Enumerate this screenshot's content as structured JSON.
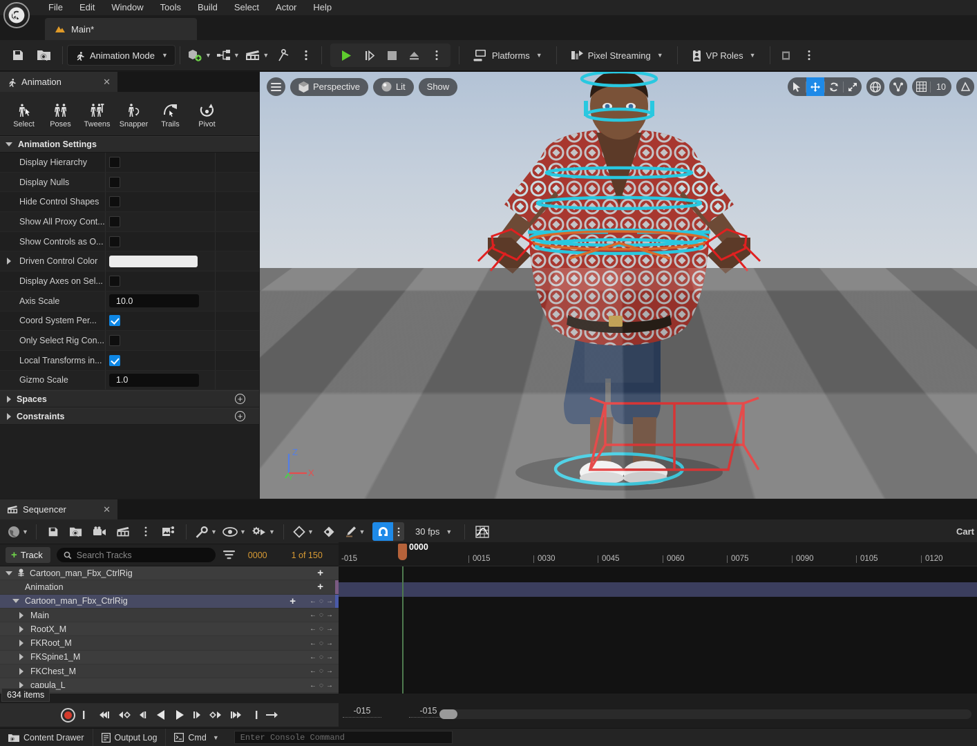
{
  "app": {
    "logo_icon": "unreal-engine-logo"
  },
  "menubar": {
    "items": [
      {
        "label": "File"
      },
      {
        "label": "Edit"
      },
      {
        "label": "Window"
      },
      {
        "label": "Tools"
      },
      {
        "label": "Build"
      },
      {
        "label": "Select"
      },
      {
        "label": "Actor"
      },
      {
        "label": "Help"
      }
    ]
  },
  "level_tab": {
    "label": "Main*",
    "icon": "level-icon"
  },
  "main_toolbar": {
    "save_icon": "save-icon",
    "browse_icon": "browse-content-icon",
    "mode_label": "Animation Mode",
    "mode_icon": "animation-mode-icon",
    "add_icon": "add-actor-icon",
    "blueprint_icon": "blueprints-icon",
    "cinematics_icon": "cinematics-icon",
    "tools_icon": "virtual-production-icon",
    "more_icon": "more-options-icon",
    "play_icon": "play-icon",
    "skipplay_icon": "play-step-icon",
    "stop_icon": "stop-icon",
    "eject_icon": "eject-icon",
    "play_more_icon": "play-options-icon",
    "platforms_label": "Platforms",
    "platforms_icon": "platforms-icon",
    "pixel_streaming_label": "Pixel Streaming",
    "pixel_streaming_icon": "pixel-streaming-icon",
    "vp_roles_label": "VP Roles",
    "vp_roles_icon": "vp-roles-icon",
    "vcam_icon": "vcam-icon",
    "settings_more_icon": "settings-more-icon"
  },
  "animation_panel": {
    "tab_label": "Animation",
    "tab_icon": "animation-icon",
    "close_icon": "close-icon",
    "tools": [
      {
        "label": "Select",
        "icon": "select-tool-icon"
      },
      {
        "label": "Poses",
        "icon": "poses-tool-icon"
      },
      {
        "label": "Tweens",
        "icon": "tweens-tool-icon"
      },
      {
        "label": "Snapper",
        "icon": "snapper-tool-icon"
      },
      {
        "label": "Trails",
        "icon": "trails-tool-icon"
      },
      {
        "label": "Pivot",
        "icon": "pivot-tool-icon"
      }
    ],
    "section_title": "Animation Settings",
    "properties": [
      {
        "label": "Display Hierarchy",
        "type": "checkbox",
        "value": false,
        "expandable": false
      },
      {
        "label": "Display Nulls",
        "type": "checkbox",
        "value": false,
        "expandable": false
      },
      {
        "label": "Hide Control Shapes",
        "type": "checkbox",
        "value": false,
        "expandable": false
      },
      {
        "label": "Show All Proxy Cont...",
        "type": "checkbox",
        "value": false,
        "expandable": false
      },
      {
        "label": "Show Controls as O...",
        "type": "checkbox",
        "value": false,
        "expandable": false
      },
      {
        "label": "Driven Control Color",
        "type": "color",
        "value": "#ececec",
        "expandable": true
      },
      {
        "label": "Display Axes on Sel...",
        "type": "checkbox",
        "value": false,
        "expandable": false
      },
      {
        "label": "Axis Scale",
        "type": "number",
        "value": "10.0",
        "expandable": false
      },
      {
        "label": "Coord System Per...",
        "type": "checkbox",
        "value": true,
        "expandable": false
      },
      {
        "label": "Only Select Rig Con...",
        "type": "checkbox",
        "value": false,
        "expandable": false
      },
      {
        "label": "Local Transforms in...",
        "type": "checkbox",
        "value": true,
        "expandable": false
      },
      {
        "label": "Gizmo Scale",
        "type": "number",
        "value": "1.0",
        "expandable": false
      }
    ],
    "categories": [
      {
        "label": "Spaces",
        "add_icon": "add-circle-icon"
      },
      {
        "label": "Constraints",
        "add_icon": "add-circle-icon"
      }
    ]
  },
  "viewport": {
    "menu_icon": "viewport-menu-icon",
    "view_mode_label": "Perspective",
    "view_mode_icon": "perspective-cube-icon",
    "lighting_label": "Lit",
    "lighting_icon": "lit-sphere-icon",
    "show_label": "Show",
    "transform_tools": [
      {
        "icon": "select-cursor-icon",
        "active": false
      },
      {
        "icon": "move-gizmo-icon",
        "active": true
      },
      {
        "icon": "rotate-gizmo-icon",
        "active": false
      },
      {
        "icon": "scale-gizmo-icon",
        "active": false
      }
    ],
    "coord_icon": "world-coordinate-icon",
    "surface_snap_icon": "surface-snapping-icon",
    "grid_snap_icon": "grid-snap-icon",
    "grid_snap_value": "10",
    "angle_snap_icon": "angle-snap-icon",
    "gizmo_axes": [
      "Z",
      "X",
      "Y"
    ]
  },
  "sequencer": {
    "tab_label": "Sequencer",
    "tab_icon": "sequencer-icon",
    "close_icon": "close-icon",
    "toolbar": {
      "world_icon": "world-outliner-icon",
      "save_icon": "save-icon",
      "save_as_icon": "save-as-icon",
      "camera_icon": "create-camera-icon",
      "sequence_icon": "sequence-icon",
      "more_icon": "more-options-icon",
      "actions_icon": "sequencer-actions-icon",
      "wrench_icon": "wrench-icon",
      "eye_icon": "visibility-icon",
      "playback_icon": "playback-options-icon",
      "key_icon": "key-interpolation-icon",
      "key_area_icon": "key-area-icon",
      "pencil_icon": "autokey-icon",
      "snap_icon": "snap-magnet-icon",
      "snap_active": true,
      "snap_more_icon": "snap-options-icon",
      "fps_label": "30 fps",
      "curve_editor_icon": "curve-editor-icon",
      "right_label": "Cart"
    },
    "add_row": {
      "track_button_label": "Track",
      "track_button_icon": "plus-icon",
      "search_placeholder": "Search Tracks",
      "search_icon": "search-icon",
      "filter_icon": "filter-icon",
      "frame_counter": "0000",
      "selection_counter": "1 of 150"
    },
    "tracks": [
      {
        "label": "Cartoon_man_Fbx_CtrlRig",
        "indent": 0,
        "expander": "down",
        "icon": "skeleton-icon",
        "add": true,
        "keynav": false
      },
      {
        "label": "Animation",
        "indent": 1,
        "expander": "none",
        "icon": "none",
        "add": true,
        "keynav": false,
        "accent": "#7a5a82"
      },
      {
        "label": "Cartoon_man_Fbx_CtrlRig",
        "indent": 1,
        "expander": "down",
        "icon": "none",
        "add": true,
        "keynav": true,
        "selected": true,
        "accent": "#4a5aa8"
      },
      {
        "label": "Main",
        "indent": 2,
        "expander": "right",
        "icon": "none",
        "add": false,
        "keynav": true
      },
      {
        "label": "RootX_M",
        "indent": 2,
        "expander": "right",
        "icon": "none",
        "add": false,
        "keynav": true
      },
      {
        "label": "FKRoot_M",
        "indent": 2,
        "expander": "right",
        "icon": "none",
        "add": false,
        "keynav": true
      },
      {
        "label": "FKSpine1_M",
        "indent": 2,
        "expander": "right",
        "icon": "none",
        "add": false,
        "keynav": true
      },
      {
        "label": "FKChest_M",
        "indent": 2,
        "expander": "right",
        "icon": "none",
        "add": false,
        "keynav": true
      },
      {
        "label": "capula_L",
        "indent": 2,
        "expander": "right",
        "icon": "none",
        "add": false,
        "keynav": true
      }
    ],
    "items_tooltip": "634 items",
    "ruler": {
      "playhead_label": "0000",
      "ticks": [
        "-015",
        "0000",
        "0015",
        "0030",
        "0045",
        "0060",
        "0075",
        "0090",
        "0105",
        "0120"
      ]
    },
    "transport": {
      "record_icon": "record-icon",
      "buttons": [
        {
          "icon": "jump-to-start-icon"
        },
        {
          "icon": "step-back-frames-icon"
        },
        {
          "icon": "previous-key-icon"
        },
        {
          "icon": "step-back-icon"
        },
        {
          "icon": "play-reverse-icon"
        },
        {
          "icon": "play-forward-icon"
        },
        {
          "icon": "step-forward-icon"
        },
        {
          "icon": "next-key-icon"
        },
        {
          "icon": "step-forward-frames-icon"
        },
        {
          "icon": "jump-to-end-icon"
        },
        {
          "icon": "loop-icon"
        }
      ]
    },
    "range_start": "-015",
    "range_end": "-015"
  },
  "statusbar": {
    "content_drawer_label": "Content Drawer",
    "content_drawer_icon": "content-drawer-icon",
    "output_log_label": "Output Log",
    "output_log_icon": "output-log-icon",
    "cmd_label": "Cmd",
    "cmd_icon": "cmd-icon",
    "console_placeholder": "Enter Console Command"
  },
  "colors": {
    "accent_blue": "#1e8ae8",
    "accent_orange": "#d99b34",
    "accent_green": "#6fd44a",
    "rig_cyan": "#29c8e0",
    "playhead": "#b5623a"
  }
}
